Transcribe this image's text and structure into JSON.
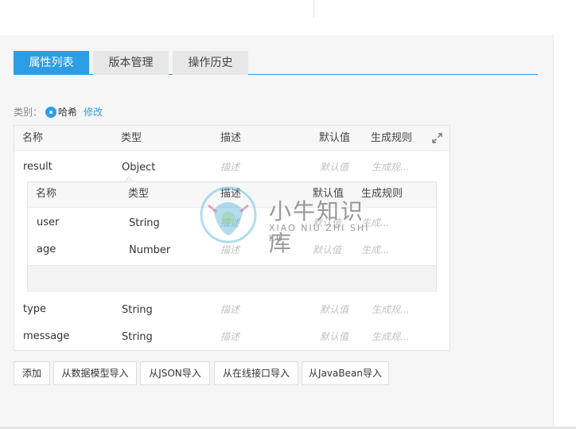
{
  "tabs": [
    {
      "label": "属性列表",
      "active": true
    },
    {
      "label": "版本管理",
      "active": false
    },
    {
      "label": "操作历史",
      "active": false
    }
  ],
  "category": {
    "label": "类别：",
    "selected": "哈希",
    "edit_label": "修改"
  },
  "table": {
    "columns": [
      "名称",
      "类型",
      "描述",
      "默认值",
      "生成规则"
    ],
    "rows": [
      {
        "name": "result",
        "type": "Object",
        "desc": "描述",
        "default": "默认值",
        "rule": "生成规..."
      },
      {
        "name": "type",
        "type": "String",
        "desc": "描述",
        "default": "默认值",
        "rule": "生成规..."
      },
      {
        "name": "message",
        "type": "String",
        "desc": "描述",
        "default": "默认值",
        "rule": "生成规..."
      }
    ],
    "sub": {
      "columns": [
        "名称",
        "类型",
        "描述",
        "默认值",
        "生成规则"
      ],
      "rows": [
        {
          "name": "user",
          "type": "String",
          "desc": "描述",
          "default": "默认值",
          "rule": "生成..."
        },
        {
          "name": "age",
          "type": "Number",
          "desc": "描述",
          "default": "默认值",
          "rule": "生成..."
        }
      ]
    }
  },
  "buttons": [
    "添加",
    "从数据模型导入",
    "从JSON导入",
    "从在线接口导入",
    "从JavaBean导入"
  ],
  "watermark": {
    "text": "小牛知识库",
    "pinyin": "XIAO NIU ZHI SHI KU"
  },
  "colors": {
    "accent": "#2d9de6",
    "panel_bg": "#f6f6f6"
  },
  "icons": {
    "expand": "expand-icon",
    "radio": "radio-selected-icon"
  }
}
